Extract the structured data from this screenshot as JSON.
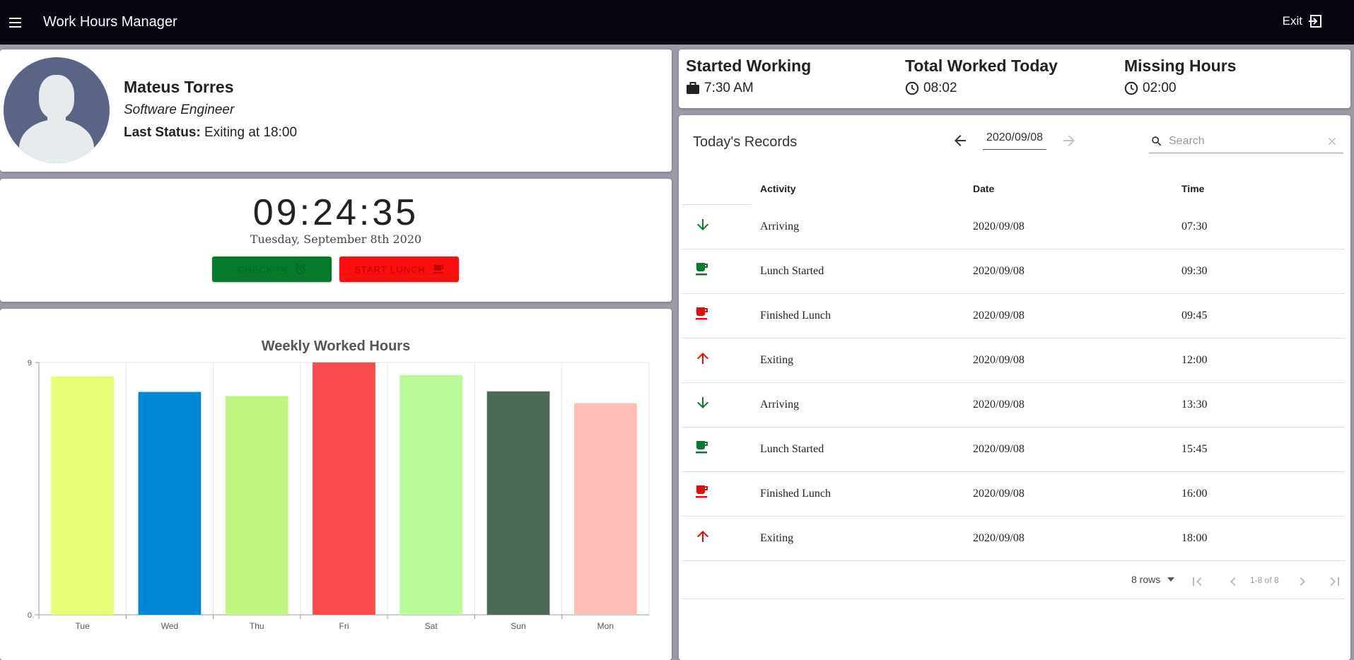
{
  "app": {
    "title": "Work Hours Manager",
    "exit_label": "Exit"
  },
  "profile": {
    "name": "Mateus Torres",
    "role": "Software Engineer",
    "status_label": "Last Status:",
    "status_value": "Exiting at 18:00"
  },
  "clock": {
    "time": "09:24:35",
    "date": "Tuesday, September 8th 2020",
    "checkin_label": "CHECK-IN",
    "lunch_label": "START LUNCH"
  },
  "chart_data": {
    "type": "bar",
    "title": "Weekly Worked Hours",
    "categories": [
      "Tue",
      "Wed",
      "Thu",
      "Fri",
      "Sat",
      "Sun",
      "Mon"
    ],
    "values": [
      8.5,
      7.95,
      7.8,
      9.0,
      8.55,
      7.97,
      7.55
    ],
    "colors": [
      "#e6ff77",
      "#0088d6",
      "#c2f57f",
      "#fa4b4d",
      "#baf999",
      "#4c6a58",
      "#fdbfb7"
    ],
    "ylim": [
      0,
      9
    ],
    "yticks": [
      "0",
      "9"
    ],
    "grid": true
  },
  "stats": {
    "started": {
      "title": "Started Working",
      "value": "7:30 AM",
      "icon": "briefcase-icon"
    },
    "total": {
      "title": "Total Worked Today",
      "value": "08:02",
      "icon": "clock-icon"
    },
    "missing": {
      "title": "Missing Hours",
      "value": "02:00",
      "icon": "clock-icon"
    }
  },
  "records": {
    "title": "Today's Records",
    "date": "2020/09/08",
    "search_placeholder": "Search",
    "columns": [
      "Activity",
      "Date",
      "Time"
    ],
    "rows": [
      {
        "icon": "arrow-down-icon",
        "color": "#0a7a2f",
        "activity": "Arriving",
        "date": "2020/09/08",
        "time": "07:30"
      },
      {
        "icon": "coffee-icon",
        "color": "#0a7a2f",
        "activity": "Lunch Started",
        "date": "2020/09/08",
        "time": "09:30"
      },
      {
        "icon": "coffee-icon",
        "color": "#e60a0a",
        "activity": "Finished Lunch",
        "date": "2020/09/08",
        "time": "09:45"
      },
      {
        "icon": "arrow-up-icon",
        "color": "#e60a0a",
        "activity": "Exiting",
        "date": "2020/09/08",
        "time": "12:00"
      },
      {
        "icon": "arrow-down-icon",
        "color": "#0a7a2f",
        "activity": "Arriving",
        "date": "2020/09/08",
        "time": "13:30"
      },
      {
        "icon": "coffee-icon",
        "color": "#0a7a2f",
        "activity": "Lunch Started",
        "date": "2020/09/08",
        "time": "15:45"
      },
      {
        "icon": "coffee-icon",
        "color": "#e60a0a",
        "activity": "Finished Lunch",
        "date": "2020/09/08",
        "time": "16:00"
      },
      {
        "icon": "arrow-up-icon",
        "color": "#e60a0a",
        "activity": "Exiting",
        "date": "2020/09/08",
        "time": "18:00"
      }
    ],
    "rows_per_page": "8 rows",
    "page_info": "1-8 of 8"
  }
}
